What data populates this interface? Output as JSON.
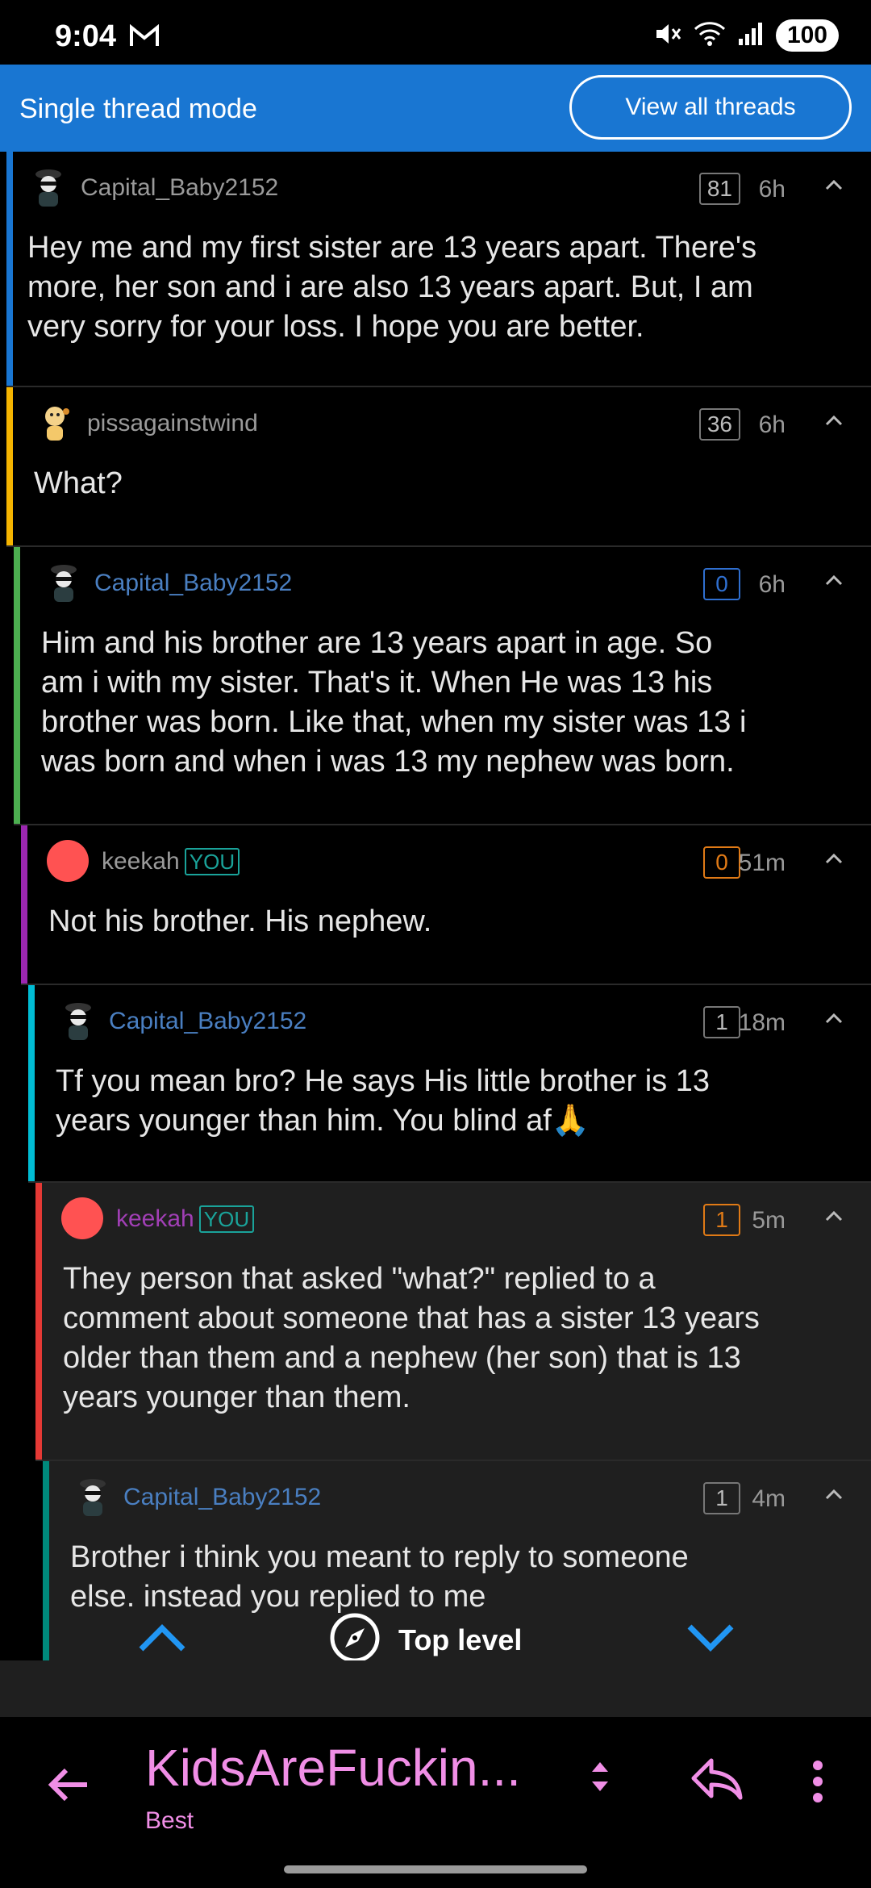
{
  "status": {
    "time": "9:04",
    "battery": "100"
  },
  "mode": {
    "title": "Single thread mode",
    "view_all": "View all threads"
  },
  "comments": [
    {
      "author": "Capital_Baby2152",
      "score": "81",
      "age": "6h",
      "body": [
        "Hey me and my first sister are 13 years apart. There's",
        "more, her son and i are also 13 years apart. But, I am",
        "very sorry for your loss. I hope you are better."
      ],
      "bar_color": "#1976d2",
      "author_color": "#9a9a9a",
      "score_color": "#8a8a8a"
    },
    {
      "author": "pissagainstwind",
      "score": "36",
      "age": "6h",
      "body": [
        "What?"
      ],
      "bar_color": "#f5b400",
      "author_color": "#9a9a9a",
      "score_color": "#8a8a8a"
    },
    {
      "author": "Capital_Baby2152",
      "score": "0",
      "age": "6h",
      "body": [
        "Him and his brother are 13 years apart in age. So",
        "am i with my sister. That's it. When He was 13 his",
        "brother was born. Like that, when my sister was 13 i",
        "was born and when i was 13 my nephew was born."
      ],
      "bar_color": "#4caf50",
      "author_color": "#4a7fc1",
      "score_color": "#2f6fd0"
    },
    {
      "author": "keekah",
      "you": "YOU",
      "score": "0",
      "age": "51m",
      "body": [
        "Not his brother. His nephew."
      ],
      "bar_color": "#9c27b0",
      "author_color": "#9a9a9a",
      "score_color": "#e07a16"
    },
    {
      "author": "Capital_Baby2152",
      "score": "1",
      "age": "18m",
      "body": [
        "Tf you mean bro? He says His little brother is 13",
        "years younger than him. You blind af🙏"
      ],
      "bar_color": "#00bcd4",
      "author_color": "#4a7fc1",
      "score_color": "#8a8a8a"
    },
    {
      "author": "keekah",
      "you": "YOU",
      "score": "1",
      "age": "5m",
      "body": [
        "They person that asked \"what?\" replied to a",
        "comment about someone that has a sister 13 years",
        "older than them and a nephew (her son) that is 13",
        "years younger than them."
      ],
      "bar_color": "#e53935",
      "author_color": "#a13fb5",
      "score_color": "#e07a16"
    },
    {
      "author": "Capital_Baby2152",
      "score": "1",
      "age": "4m",
      "body": [
        "Brother i think you meant to reply to someone",
        "else. instead you replied to me"
      ],
      "bar_color": "#00897b",
      "author_color": "#4a7fc1",
      "score_color": "#8a8a8a"
    }
  ],
  "nav": {
    "top_level": "Top level"
  },
  "bottom": {
    "subreddit": "KidsAreFuckin...",
    "sort": "Best"
  },
  "icons": [
    "silent-icon",
    "wifi-icon",
    "signal-icon",
    "chevron-up-icon",
    "chevron-down-icon",
    "compass-icon",
    "back-arrow-icon",
    "sort-icon",
    "reply-icon",
    "more-vert-icon"
  ]
}
